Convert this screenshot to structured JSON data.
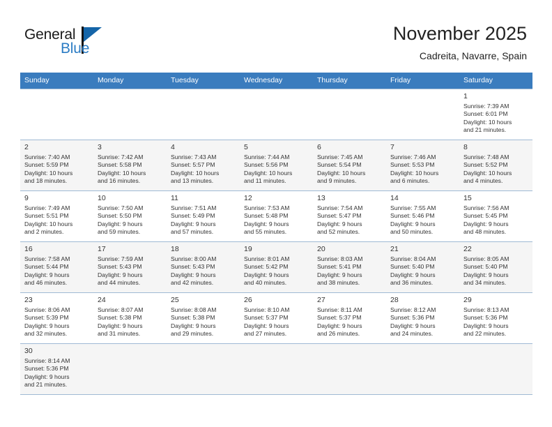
{
  "brand": {
    "name_part1": "General",
    "name_part2": "Blue",
    "accent_color": "#2b7cc4",
    "flag_color": "#1565a8"
  },
  "header": {
    "title": "November 2025",
    "subtitle": "Cadreita, Navarre, Spain"
  },
  "calendar": {
    "header_bg": "#3a7cbe",
    "weekdays": [
      "Sunday",
      "Monday",
      "Tuesday",
      "Wednesday",
      "Thursday",
      "Friday",
      "Saturday"
    ],
    "weeks": [
      {
        "shaded": false,
        "days": [
          {
            "empty": true
          },
          {
            "empty": true
          },
          {
            "empty": true
          },
          {
            "empty": true
          },
          {
            "empty": true
          },
          {
            "empty": true
          },
          {
            "day": "1",
            "sunrise": "Sunrise: 7:39 AM",
            "sunset": "Sunset: 6:01 PM",
            "daylight1": "Daylight: 10 hours",
            "daylight2": "and 21 minutes."
          }
        ]
      },
      {
        "shaded": true,
        "days": [
          {
            "day": "2",
            "sunrise": "Sunrise: 7:40 AM",
            "sunset": "Sunset: 5:59 PM",
            "daylight1": "Daylight: 10 hours",
            "daylight2": "and 18 minutes."
          },
          {
            "day": "3",
            "sunrise": "Sunrise: 7:42 AM",
            "sunset": "Sunset: 5:58 PM",
            "daylight1": "Daylight: 10 hours",
            "daylight2": "and 16 minutes."
          },
          {
            "day": "4",
            "sunrise": "Sunrise: 7:43 AM",
            "sunset": "Sunset: 5:57 PM",
            "daylight1": "Daylight: 10 hours",
            "daylight2": "and 13 minutes."
          },
          {
            "day": "5",
            "sunrise": "Sunrise: 7:44 AM",
            "sunset": "Sunset: 5:56 PM",
            "daylight1": "Daylight: 10 hours",
            "daylight2": "and 11 minutes."
          },
          {
            "day": "6",
            "sunrise": "Sunrise: 7:45 AM",
            "sunset": "Sunset: 5:54 PM",
            "daylight1": "Daylight: 10 hours",
            "daylight2": "and 9 minutes."
          },
          {
            "day": "7",
            "sunrise": "Sunrise: 7:46 AM",
            "sunset": "Sunset: 5:53 PM",
            "daylight1": "Daylight: 10 hours",
            "daylight2": "and 6 minutes."
          },
          {
            "day": "8",
            "sunrise": "Sunrise: 7:48 AM",
            "sunset": "Sunset: 5:52 PM",
            "daylight1": "Daylight: 10 hours",
            "daylight2": "and 4 minutes."
          }
        ]
      },
      {
        "shaded": false,
        "days": [
          {
            "day": "9",
            "sunrise": "Sunrise: 7:49 AM",
            "sunset": "Sunset: 5:51 PM",
            "daylight1": "Daylight: 10 hours",
            "daylight2": "and 2 minutes."
          },
          {
            "day": "10",
            "sunrise": "Sunrise: 7:50 AM",
            "sunset": "Sunset: 5:50 PM",
            "daylight1": "Daylight: 9 hours",
            "daylight2": "and 59 minutes."
          },
          {
            "day": "11",
            "sunrise": "Sunrise: 7:51 AM",
            "sunset": "Sunset: 5:49 PM",
            "daylight1": "Daylight: 9 hours",
            "daylight2": "and 57 minutes."
          },
          {
            "day": "12",
            "sunrise": "Sunrise: 7:53 AM",
            "sunset": "Sunset: 5:48 PM",
            "daylight1": "Daylight: 9 hours",
            "daylight2": "and 55 minutes."
          },
          {
            "day": "13",
            "sunrise": "Sunrise: 7:54 AM",
            "sunset": "Sunset: 5:47 PM",
            "daylight1": "Daylight: 9 hours",
            "daylight2": "and 52 minutes."
          },
          {
            "day": "14",
            "sunrise": "Sunrise: 7:55 AM",
            "sunset": "Sunset: 5:46 PM",
            "daylight1": "Daylight: 9 hours",
            "daylight2": "and 50 minutes."
          },
          {
            "day": "15",
            "sunrise": "Sunrise: 7:56 AM",
            "sunset": "Sunset: 5:45 PM",
            "daylight1": "Daylight: 9 hours",
            "daylight2": "and 48 minutes."
          }
        ]
      },
      {
        "shaded": true,
        "days": [
          {
            "day": "16",
            "sunrise": "Sunrise: 7:58 AM",
            "sunset": "Sunset: 5:44 PM",
            "daylight1": "Daylight: 9 hours",
            "daylight2": "and 46 minutes."
          },
          {
            "day": "17",
            "sunrise": "Sunrise: 7:59 AM",
            "sunset": "Sunset: 5:43 PM",
            "daylight1": "Daylight: 9 hours",
            "daylight2": "and 44 minutes."
          },
          {
            "day": "18",
            "sunrise": "Sunrise: 8:00 AM",
            "sunset": "Sunset: 5:43 PM",
            "daylight1": "Daylight: 9 hours",
            "daylight2": "and 42 minutes."
          },
          {
            "day": "19",
            "sunrise": "Sunrise: 8:01 AM",
            "sunset": "Sunset: 5:42 PM",
            "daylight1": "Daylight: 9 hours",
            "daylight2": "and 40 minutes."
          },
          {
            "day": "20",
            "sunrise": "Sunrise: 8:03 AM",
            "sunset": "Sunset: 5:41 PM",
            "daylight1": "Daylight: 9 hours",
            "daylight2": "and 38 minutes."
          },
          {
            "day": "21",
            "sunrise": "Sunrise: 8:04 AM",
            "sunset": "Sunset: 5:40 PM",
            "daylight1": "Daylight: 9 hours",
            "daylight2": "and 36 minutes."
          },
          {
            "day": "22",
            "sunrise": "Sunrise: 8:05 AM",
            "sunset": "Sunset: 5:40 PM",
            "daylight1": "Daylight: 9 hours",
            "daylight2": "and 34 minutes."
          }
        ]
      },
      {
        "shaded": false,
        "days": [
          {
            "day": "23",
            "sunrise": "Sunrise: 8:06 AM",
            "sunset": "Sunset: 5:39 PM",
            "daylight1": "Daylight: 9 hours",
            "daylight2": "and 32 minutes."
          },
          {
            "day": "24",
            "sunrise": "Sunrise: 8:07 AM",
            "sunset": "Sunset: 5:38 PM",
            "daylight1": "Daylight: 9 hours",
            "daylight2": "and 31 minutes."
          },
          {
            "day": "25",
            "sunrise": "Sunrise: 8:08 AM",
            "sunset": "Sunset: 5:38 PM",
            "daylight1": "Daylight: 9 hours",
            "daylight2": "and 29 minutes."
          },
          {
            "day": "26",
            "sunrise": "Sunrise: 8:10 AM",
            "sunset": "Sunset: 5:37 PM",
            "daylight1": "Daylight: 9 hours",
            "daylight2": "and 27 minutes."
          },
          {
            "day": "27",
            "sunrise": "Sunrise: 8:11 AM",
            "sunset": "Sunset: 5:37 PM",
            "daylight1": "Daylight: 9 hours",
            "daylight2": "and 26 minutes."
          },
          {
            "day": "28",
            "sunrise": "Sunrise: 8:12 AM",
            "sunset": "Sunset: 5:36 PM",
            "daylight1": "Daylight: 9 hours",
            "daylight2": "and 24 minutes."
          },
          {
            "day": "29",
            "sunrise": "Sunrise: 8:13 AM",
            "sunset": "Sunset: 5:36 PM",
            "daylight1": "Daylight: 9 hours",
            "daylight2": "and 22 minutes."
          }
        ]
      },
      {
        "shaded": true,
        "days": [
          {
            "day": "30",
            "sunrise": "Sunrise: 8:14 AM",
            "sunset": "Sunset: 5:36 PM",
            "daylight1": "Daylight: 9 hours",
            "daylight2": "and 21 minutes."
          },
          {
            "empty": true
          },
          {
            "empty": true
          },
          {
            "empty": true
          },
          {
            "empty": true
          },
          {
            "empty": true
          },
          {
            "empty": true
          }
        ]
      }
    ]
  }
}
